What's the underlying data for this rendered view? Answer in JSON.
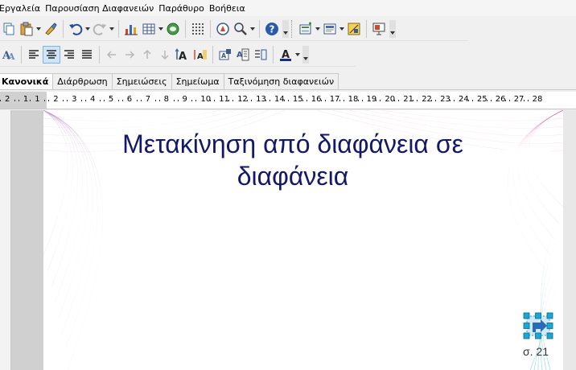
{
  "menubar": {
    "items": [
      "Εργαλεία",
      "Παρουσίαση Διαφανειών",
      "Παράθυρο",
      "Βοήθεια"
    ]
  },
  "toolbar1": {
    "icons": [
      "copy-icon",
      "paste-icon",
      "clone-formatting-icon",
      "undo-icon",
      "redo-icon",
      "chart-icon",
      "table-icon",
      "spreadsheet-icon",
      "grid-icon",
      "navigator-icon",
      "zoom-icon",
      "help-icon",
      "slide-layout-icon",
      "slide-design-icon",
      "display-grid-icon",
      "presentation-icon"
    ]
  },
  "toolbar2": {
    "icons": [
      "fontwork-icon",
      "align-left-icon",
      "align-center-icon",
      "align-right-icon",
      "justify-icon",
      "arrow-left-icon",
      "arrow-right-icon",
      "arrow-up-icon",
      "arrow-down-icon",
      "text-grow-icon",
      "text-shrink-icon",
      "text-box-icon",
      "paragraph-icon",
      "character-icon",
      "font-color-icon"
    ],
    "font_color": "#1a2a8a"
  },
  "view_tabs": {
    "active": "Κανονικά",
    "items": [
      "Διάρθρωση",
      "Σημειώσεις",
      "Σημείωμα",
      "Ταξινόμηση διαφανειών"
    ]
  },
  "ruler": {
    "labels": [
      "2",
      "1",
      "1",
      "2",
      "3",
      "4",
      "5",
      "6",
      "7",
      "8",
      "9",
      "10",
      "11",
      "12",
      "13",
      "14",
      "15",
      "16",
      "17",
      "18",
      "19",
      "20",
      "21",
      "22",
      "23",
      "24",
      "25",
      "26",
      "27",
      "28"
    ]
  },
  "slide": {
    "title_line1": "Μετακίνηση από διαφάνεια σε",
    "title_line2": "διαφάνεια",
    "slide_number": "σ. 21"
  },
  "colors": {
    "title": "#141869",
    "selection_handles": "#1aa7d6"
  }
}
